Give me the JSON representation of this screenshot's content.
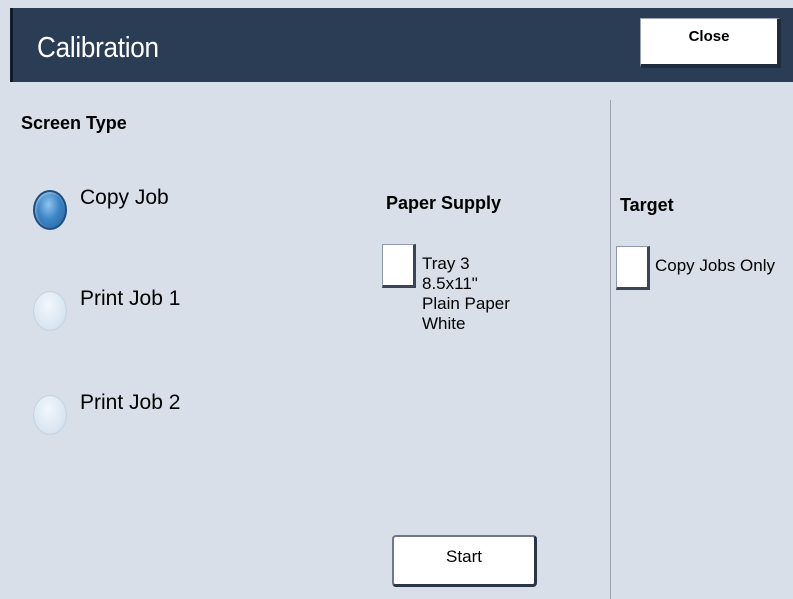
{
  "header": {
    "title": "Calibration",
    "close_label": "Close"
  },
  "screen_type": {
    "label": "Screen Type",
    "options": [
      {
        "label": "Copy Job",
        "selected": true
      },
      {
        "label": "Print Job 1",
        "selected": false
      },
      {
        "label": "Print Job 2",
        "selected": false
      }
    ]
  },
  "paper_supply": {
    "label": "Paper Supply",
    "tray_lines": [
      "Tray 3",
      "8.5x11\"",
      "Plain Paper",
      "White"
    ]
  },
  "target": {
    "label": "Target",
    "option_label": "Copy Jobs Only"
  },
  "actions": {
    "start_label": "Start"
  },
  "colors": {
    "header_bg": "#2b3d55",
    "panel_bg": "#d8dfe9",
    "radio_selected": "#3f86c6"
  }
}
